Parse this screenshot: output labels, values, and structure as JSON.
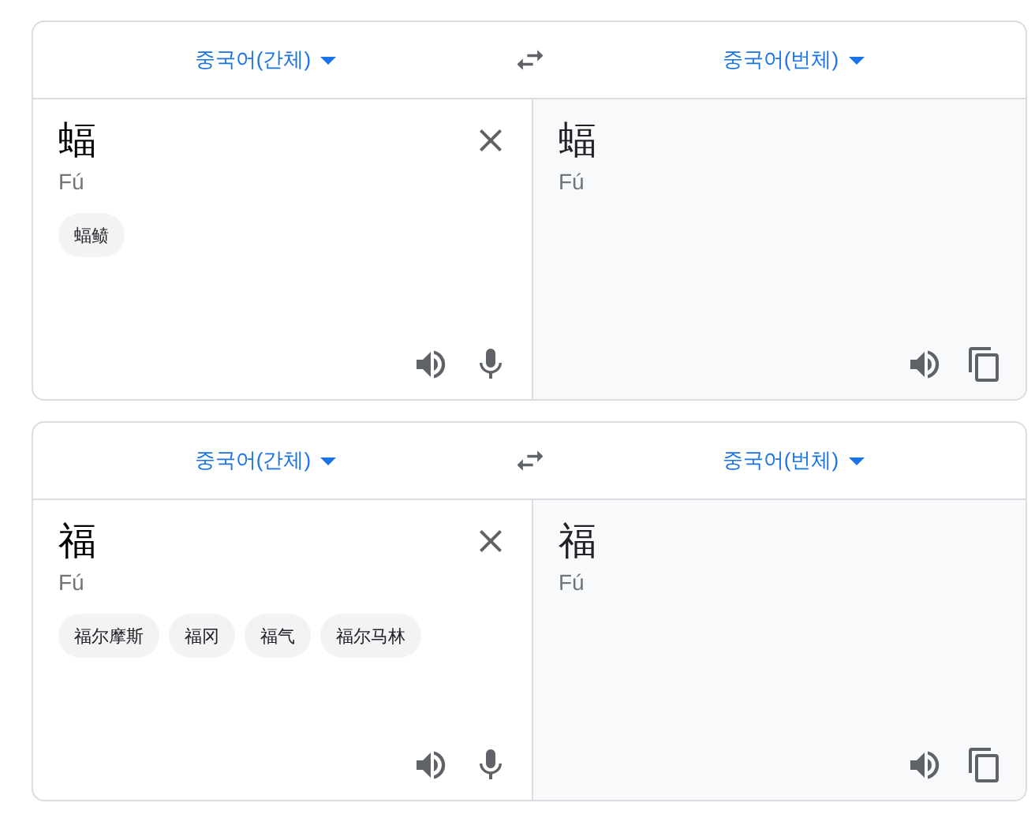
{
  "cards": [
    {
      "source_language": "중국어(간체)",
      "target_language": "중국어(번체)",
      "source_text": "蝠",
      "source_pinyin": "Fú",
      "suggestions": [
        "蝠鲼"
      ],
      "target_text": "蝠",
      "target_pinyin": "Fú"
    },
    {
      "source_language": "중국어(간체)",
      "target_language": "중국어(번체)",
      "source_text": "福",
      "source_pinyin": "Fú",
      "suggestions": [
        "福尔摩斯",
        "福冈",
        "福气",
        "福尔马林"
      ],
      "target_text": "福",
      "target_pinyin": "Fú"
    }
  ]
}
